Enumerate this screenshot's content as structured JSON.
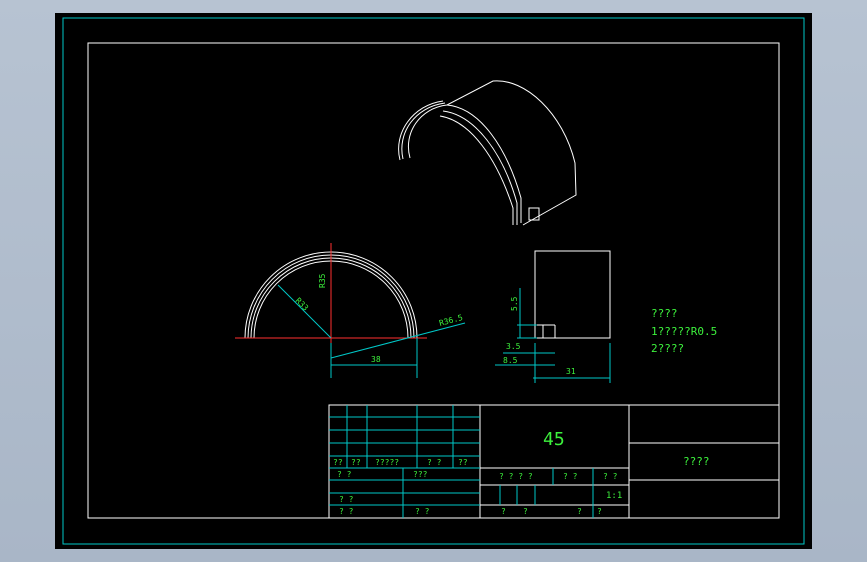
{
  "colors": {
    "frame": "#00c8c8",
    "geometry": "#ffffff",
    "dimension": "#00c8c8",
    "text": "#3cf03c",
    "centerline": "#ff3030"
  },
  "dimensions": {
    "r35": "R35",
    "r33": "R33",
    "r36_5": "R36.5",
    "width_38": "38",
    "h5_5": "5.5",
    "h3_5": "3.5",
    "w8_5": "8.5",
    "w31": "31"
  },
  "notes": {
    "title": "????",
    "line1": "1?????R0.5",
    "line2": "2????"
  },
  "title_block": {
    "material": "45",
    "part_name": "????",
    "scale": "1:1",
    "labels": {
      "r1c1": "??",
      "r1c2": "??",
      "r1c3": "?????",
      "r1c4": "? ?",
      "r1c5": "??",
      "r2c1": "? ?",
      "r2c2": "???",
      "r3c1": "? ?",
      "r4c1": "? ?",
      "r4c2": "? ?",
      "mid1": "? ? ? ?",
      "mid2": "? ?",
      "mid3": "? ?",
      "bot1": "?",
      "bot2": "?",
      "bot3": "?",
      "bot4": "?"
    }
  }
}
